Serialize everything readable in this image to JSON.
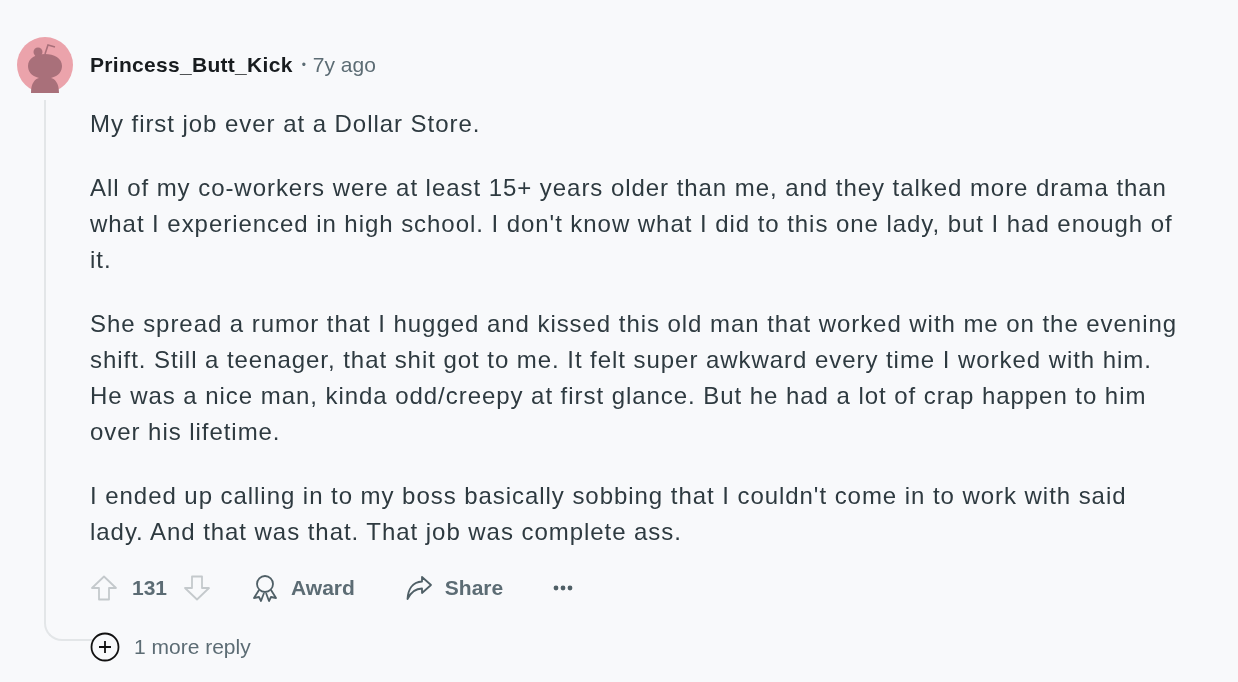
{
  "comment": {
    "author": "Princess_Butt_Kick",
    "separator": "•",
    "time": "7y ago",
    "body": [
      "My first job ever at a Dollar Store.",
      "All of my co-workers were at least 15+ years older than me, and they talked more drama than what I experienced in high school. I don't know what I did to this one lady, but I had enough of it.",
      "She spread a rumor that I hugged and kissed this old man that worked with me on the evening shift. Still a teenager, that shit got to me. It felt super awkward every time I worked with him. He was a nice man, kinda odd/creepy at first glance. But he had a lot of crap happen to him over his lifetime.",
      "I ended up calling in to my boss basically sobbing that I couldn't come in to work with said lady. And that was that. That job was complete ass."
    ],
    "score": "131",
    "actions": [
      {
        "kind": "award",
        "label": "Award"
      },
      {
        "kind": "share",
        "label": "Share"
      },
      {
        "kind": "more"
      }
    ]
  },
  "more_replies": {
    "label": "1 more reply"
  }
}
